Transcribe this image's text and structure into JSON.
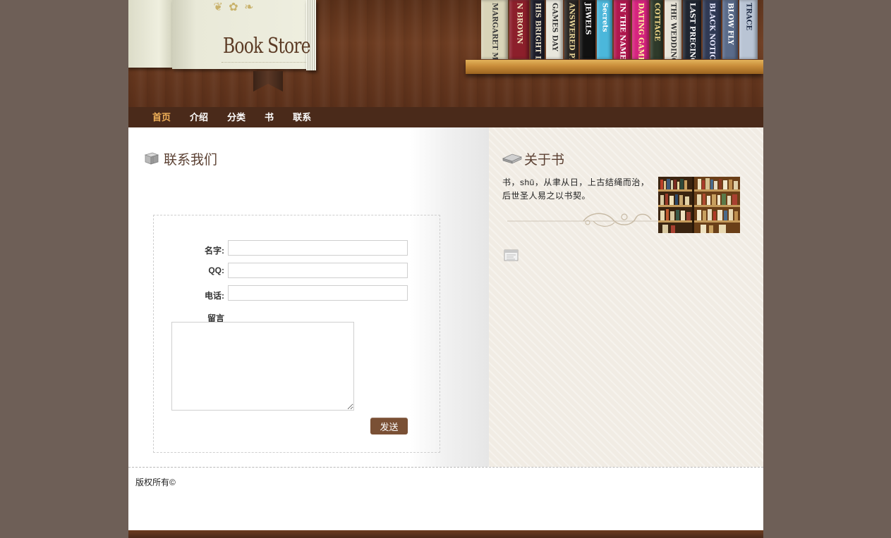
{
  "header": {
    "logo_text": "Book Store",
    "spines": [
      {
        "text": "MARGARET MITCHELL",
        "bg": "#d9d4b8",
        "fg": "#3a3a3a",
        "w": 38
      },
      {
        "text": "N BROWN",
        "bg": "#8c1f2b",
        "fg": "#f3e5c0",
        "w": 28
      },
      {
        "text": "HIS BRIGHT LIGHT",
        "bg": "#1d1d2a",
        "fg": "#e9e0c8",
        "w": 20
      },
      {
        "text": "GAMES DAY",
        "bg": "#e8e6dc",
        "fg": "#333",
        "w": 24
      },
      {
        "text": "ANSWERED PRAYERS",
        "bg": "#2a2623",
        "fg": "#e8d69a",
        "w": 20
      },
      {
        "text": "JEWELS",
        "bg": "#111111",
        "fg": "#ffffff",
        "w": 22
      },
      {
        "text": "Secrets",
        "bg": "#4bb7db",
        "fg": "#ffffff",
        "w": 22
      },
      {
        "text": "IN THE NAME",
        "bg": "#b0174e",
        "fg": "#ffffff",
        "w": 24
      },
      {
        "text": "DATING GAME",
        "bg": "#d6247e",
        "fg": "#fff5a0",
        "w": 24
      },
      {
        "text": "COTTAGE",
        "bg": "#2e3a2a",
        "fg": "#f2d98a",
        "w": 18
      },
      {
        "text": "THE WEDDING",
        "bg": "#e8e4d8",
        "fg": "#333",
        "w": 24
      },
      {
        "text": "LAST PRECINCT",
        "bg": "#1f2530",
        "fg": "#ffffff",
        "w": 26
      },
      {
        "text": "BLACK NOTICE",
        "bg": "#303a55",
        "fg": "#e9e9ff",
        "w": 26
      },
      {
        "text": "BLOW FLY",
        "bg": "#5a6b8a",
        "fg": "#ffffff",
        "w": 22
      },
      {
        "text": "TRACE",
        "bg": "#b9c4d4",
        "fg": "#1d2a44",
        "w": 26
      }
    ]
  },
  "nav": {
    "items": [
      "首页",
      "介绍",
      "分类",
      "书",
      "联系"
    ],
    "active_index": 0,
    "active_color": "#f0b058"
  },
  "contact": {
    "title": "联系我们",
    "name_label": "名字:",
    "qq_label": "QQ:",
    "phone_label": "电话:",
    "message_label": "留言",
    "name_value": "",
    "qq_value": "",
    "phone_value": "",
    "message_value": "",
    "send_label": "发送"
  },
  "about": {
    "title": "关于书",
    "text": "书，shū，从聿从日，上古结绳而治，后世圣人易之以书契。"
  },
  "footer": {
    "copyright": "版权所有©"
  }
}
